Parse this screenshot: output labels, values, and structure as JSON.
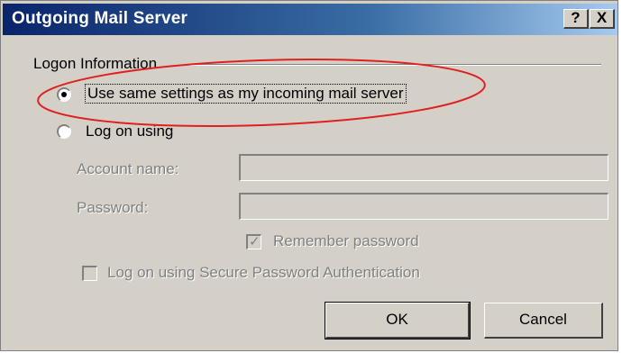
{
  "window": {
    "title": "Outgoing Mail Server",
    "help_button": "?",
    "close_button": "X"
  },
  "logon_group": {
    "label": "Logon Information",
    "options": [
      {
        "label": "Use same settings as my incoming mail server",
        "selected": true
      },
      {
        "label": "Log on using",
        "selected": false
      }
    ]
  },
  "fields": {
    "account_label": "Account name:",
    "account_value": "",
    "password_label": "Password:",
    "password_value": ""
  },
  "remember_password": {
    "label": "Remember password",
    "checked": true,
    "enabled": false
  },
  "spa": {
    "label": "Log on using Secure Password Authentication",
    "checked": false,
    "enabled": false
  },
  "buttons": {
    "ok": "OK",
    "cancel": "Cancel"
  },
  "colors": {
    "annotation_ellipse": "#e02020",
    "title_gradient_start": "#0a246a",
    "title_gradient_end": "#a6caf0",
    "dialog_face": "#d4d0c8"
  }
}
